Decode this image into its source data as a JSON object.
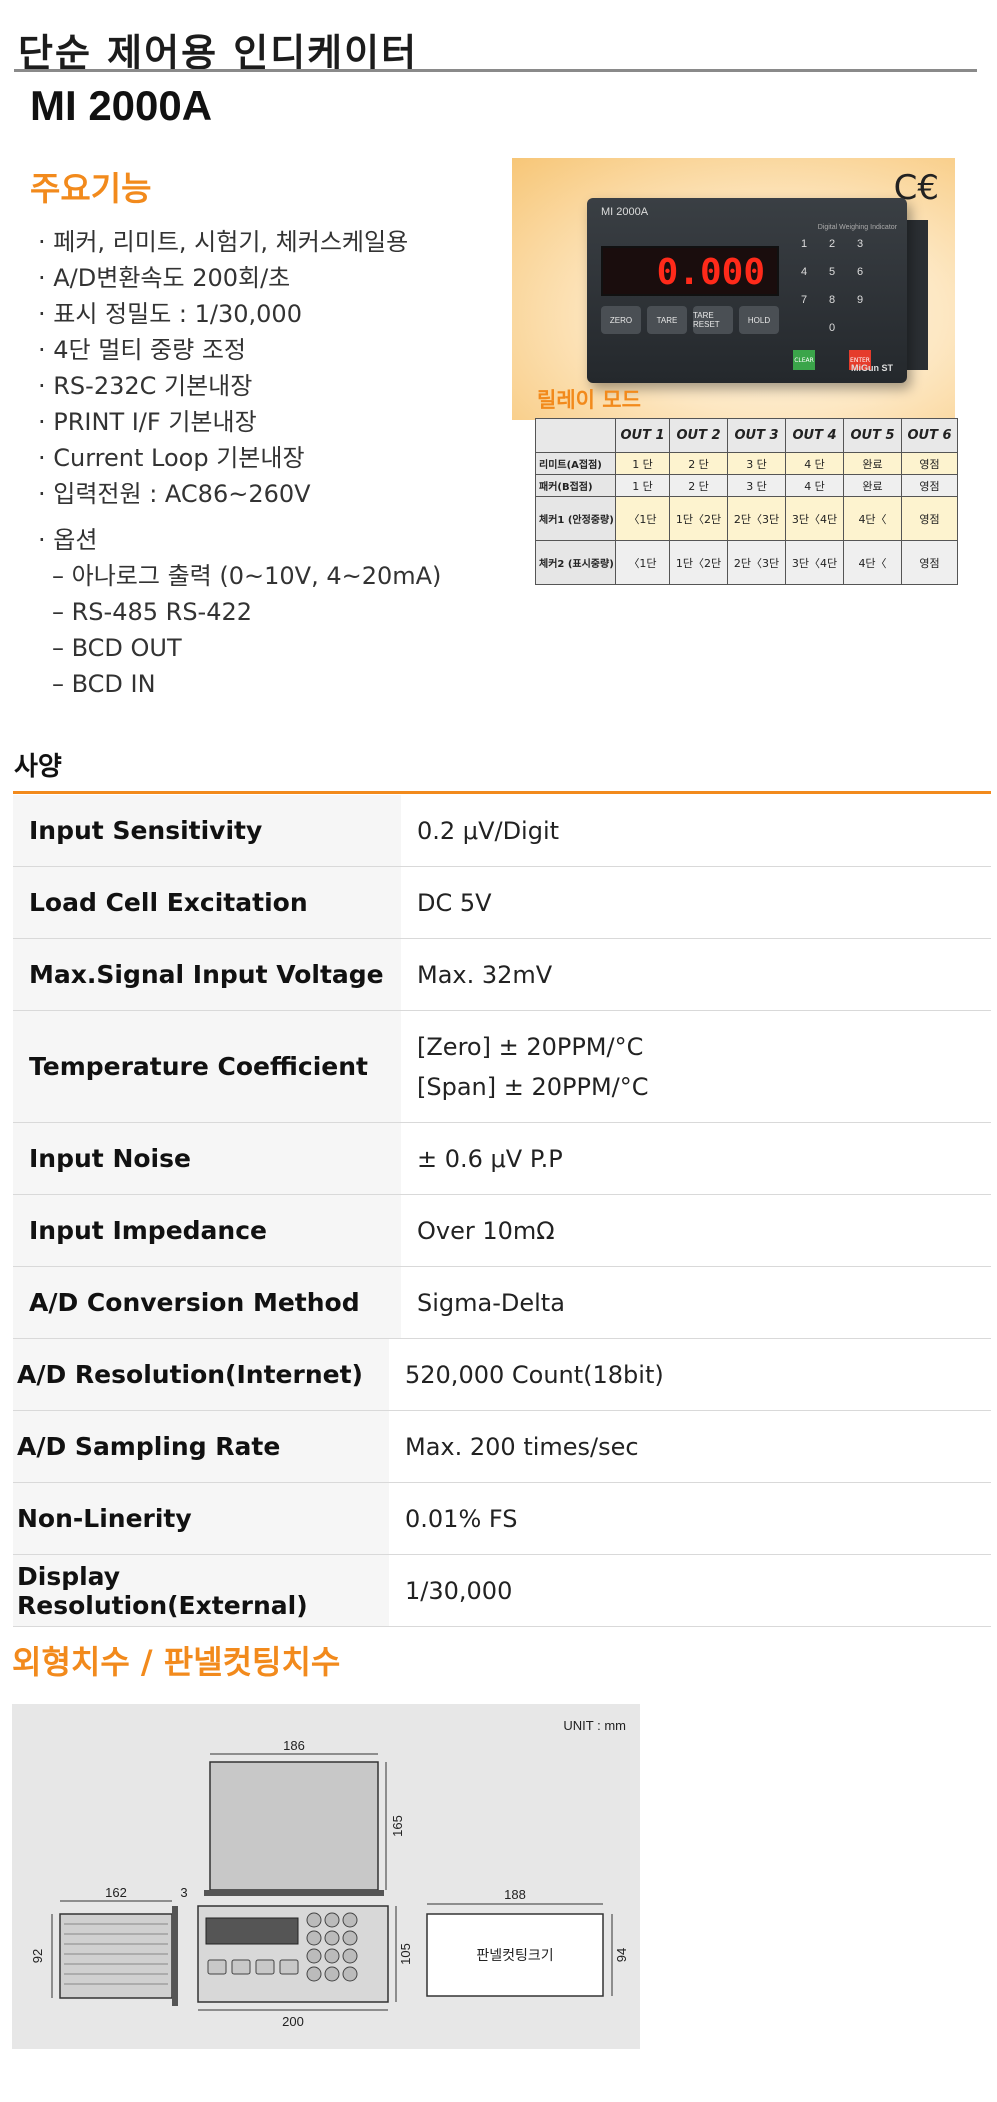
{
  "header": {
    "title": "단순 제어용 인디케이터",
    "model": "MI 2000A"
  },
  "features": {
    "title": "주요기능",
    "items": [
      "· 페커, 리미트, 시험기, 체커스케일용",
      "· A/D변환속도 200회/초",
      "· 표시 정밀도 : 1/30,000",
      "· 4단 멀티 중량 조정",
      "· RS-232C  기본내장",
      "· PRINT I/F 기본내장",
      "· Current Loop 기본내장",
      "· 입력전원 : AC86~260V"
    ],
    "options_label": "· 옵션",
    "options": [
      "–  아나로그 출력 (0~10V, 4~20mA)",
      "–  RS-485  RS-422",
      "–  BCD  OUT",
      "–  BCD  IN"
    ]
  },
  "product_image": {
    "ce_mark": "C€",
    "device_model": "MI 2000A",
    "device_subtitle": "Digital Weighing Indicator",
    "display_value": "0.000",
    "buttons": [
      "ZERO",
      "TARE",
      "TARE RESET",
      "HOLD"
    ],
    "keys": [
      "1",
      "2",
      "3",
      "4",
      "5",
      "6",
      "7",
      "8",
      "9",
      "0"
    ],
    "key_clear": "CLEAR",
    "key_enter": "ENTER",
    "brand": "MiGun ST"
  },
  "relay": {
    "title": "릴레이 모드",
    "headers": [
      "",
      "OUT 1",
      "OUT 2",
      "OUT 3",
      "OUT 4",
      "OUT 5",
      "OUT 6"
    ],
    "rows": [
      [
        "리미트(A접점)",
        "1 단",
        "2 단",
        "3 단",
        "4 단",
        "완료",
        "영점"
      ],
      [
        "패커(B접점)",
        "1 단",
        "2 단",
        "3 단",
        "4 단",
        "완료",
        "영점"
      ],
      [
        "체커1 (안정중량)",
        "〈1단",
        "1단〈2단",
        "2단〈3단",
        "3단〈4단",
        "4단〈",
        "영점"
      ],
      [
        "체커2 (표시중량)",
        "〈1단",
        "1단〈2단",
        "2단〈3단",
        "3단〈4단",
        "4단〈",
        "영점"
      ]
    ]
  },
  "specs": {
    "title": "사양",
    "rows": [
      {
        "label": "Input Sensitivity",
        "value": "0.2 μV/Digit"
      },
      {
        "label": "Load Cell Excitation",
        "value": "DC 5V"
      },
      {
        "label": "Max.Signal Input Voltage",
        "value": "Max. 32mV"
      },
      {
        "label": "Temperature Coefficient",
        "value": "[Zero] ± 20PPM/°C",
        "value2": "[Span] ± 20PPM/°C"
      },
      {
        "label": "Input Noise",
        "value": "± 0.6 μV P.P"
      },
      {
        "label": "Input Impedance",
        "value": "Over 10mΩ"
      },
      {
        "label": "A/D Conversion Method",
        "value": "Sigma-Delta"
      },
      {
        "label": "A/D Resolution(Internet)",
        "value": "520,000 Count(18bit)"
      },
      {
        "label": "A/D Sampling Rate",
        "value": "Max. 200 times/sec"
      },
      {
        "label": "Non-Linerity",
        "value": "0.01% FS"
      },
      {
        "label": "Display Resolution(External)",
        "value": "1/30,000"
      }
    ]
  },
  "dimensions": {
    "title": "외형치수 / 판넬컷팅치수",
    "unit": "UNIT : mm",
    "labels": {
      "top_width": "186",
      "top_height": "165",
      "side_depth": "162",
      "side_gap": "3",
      "side_height": "92",
      "front_height": "105",
      "front_width": "200",
      "cut_width": "188",
      "cut_height": "94",
      "cut_label": "판넬컷팅크기"
    }
  }
}
